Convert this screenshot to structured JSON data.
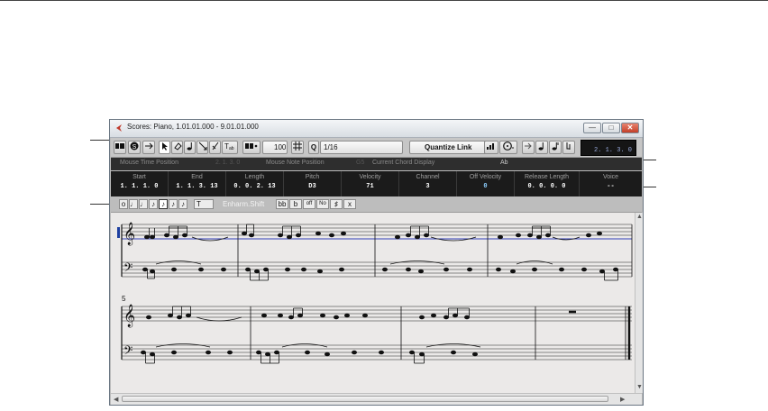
{
  "window": {
    "title": "Scores: Piano, 1.01.01.000 - 9.01.01.000",
    "controls": [
      "—",
      "□",
      "✕"
    ]
  },
  "toolbar": {
    "velocity_value": "100",
    "quantize_value": "1/16",
    "quantize_link_label": "Quantize Link",
    "position_display": "2. 1. 3.  0",
    "icons": [
      "solo-icon",
      "auto-scroll-icon",
      "object-select-icon",
      "erase-icon",
      "draw-note-icon",
      "trim-icon",
      "glue-icon",
      "layout-text-icon",
      "insert-velocity-icon",
      "q-icon"
    ]
  },
  "status_line": {
    "mouse_time_label": "Mouse Time Position",
    "mouse_time_value": "2. 1. 3.  0",
    "mouse_note_label": "Mouse Note Position",
    "mouse_note_value": "G5",
    "chord_label": "Current Chord Display",
    "chord_value": "Ab"
  },
  "info_line": [
    {
      "label": "Start",
      "value": "1. 1. 1.   0"
    },
    {
      "label": "End",
      "value": "1. 1. 3. 13"
    },
    {
      "label": "Length",
      "value": "0. 0. 2. 13"
    },
    {
      "label": "Pitch",
      "value": "D3"
    },
    {
      "label": "Velocity",
      "value": "71"
    },
    {
      "label": "Channel",
      "value": "3"
    },
    {
      "label": "Off Velocity",
      "value": "0"
    },
    {
      "label": "Release Length",
      "value": "0. 0. 0.   0"
    },
    {
      "label": "Voice",
      "value": "--"
    }
  ],
  "extended_toolbar": {
    "note_values": [
      "o",
      "♩",
      "♩",
      "♪",
      "♪",
      "♪",
      "♪"
    ],
    "tuplet_label": "T",
    "enharm_label": "Enharm.Shift",
    "enharm_options": [
      "bb",
      "b",
      "off",
      "No",
      "♯",
      "x"
    ]
  },
  "score": {
    "measure_number_row2": "5",
    "clefs": [
      "treble-clef",
      "bass-clef"
    ]
  }
}
